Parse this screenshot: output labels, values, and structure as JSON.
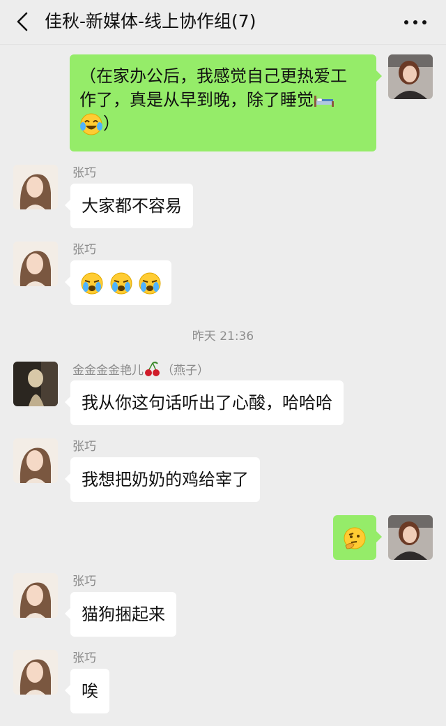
{
  "header": {
    "title": "佳秋-新媒体-线上协作组(7)"
  },
  "messages": [
    {
      "direction": "out",
      "text_line1": "（在家办公后，我感觉自己更热爱工",
      "text_line2": "作了，真是从早到晚，除了睡觉",
      "text_line3_end": "）",
      "icons": [
        "bed-icon",
        "tears-of-joy-emoji"
      ]
    },
    {
      "direction": "in",
      "sender": "张巧",
      "text": "大家都不容易"
    },
    {
      "direction": "in",
      "sender": "张巧",
      "icons": [
        "crying-emoji",
        "crying-emoji",
        "crying-emoji"
      ]
    },
    {
      "direction": "in",
      "sender": "金金金金艳儿",
      "sender_note": "（燕子）",
      "sender_icon": "cherry-icon",
      "text": "我从你这句话听出了心酸，哈哈哈"
    },
    {
      "direction": "in",
      "sender": "张巧",
      "text": "我想把奶奶的鸡给宰了"
    },
    {
      "direction": "out",
      "icons": [
        "thinking-emoji"
      ]
    },
    {
      "direction": "in",
      "sender": "张巧",
      "text": "猫狗捆起来"
    },
    {
      "direction": "in",
      "sender": "张巧",
      "text": "唉"
    }
  ],
  "timestamp": "昨天 21:36",
  "colors": {
    "background": "#ededed",
    "outgoing_bubble": "#95ec69",
    "incoming_bubble": "#ffffff"
  }
}
